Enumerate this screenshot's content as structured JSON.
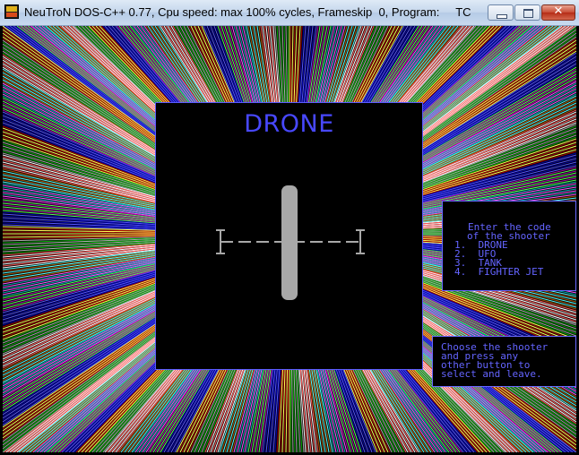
{
  "window": {
    "title": "NeuTroN DOS-C++ 0.77, Cpu speed: max 100% cycles, Frameskip  0, Program:     TC",
    "app_icon": "dosbox-icon",
    "controls": {
      "minimize": "minimize-icon",
      "maximize": "maximize-icon",
      "close_glyph": "✕"
    }
  },
  "game": {
    "selected_title": "DRONE",
    "menu": {
      "prompt_line1": "Enter the code",
      "prompt_line2": "of the shooter",
      "options": [
        {
          "number": "1.",
          "label": "DRONE"
        },
        {
          "number": "2.",
          "label": "UFO"
        },
        {
          "number": "3.",
          "label": "TANK"
        },
        {
          "number": "4.",
          "label": "FIGHTER JET"
        }
      ]
    },
    "help": {
      "line1": "Choose the shooter",
      "line2": "and press any",
      "line3": "other button to",
      "line4": "select and leave."
    },
    "colors": {
      "text": "#6464ff",
      "title": "#4848ff",
      "drone": "#a8a8a8",
      "panel_bg": "#000000"
    }
  }
}
